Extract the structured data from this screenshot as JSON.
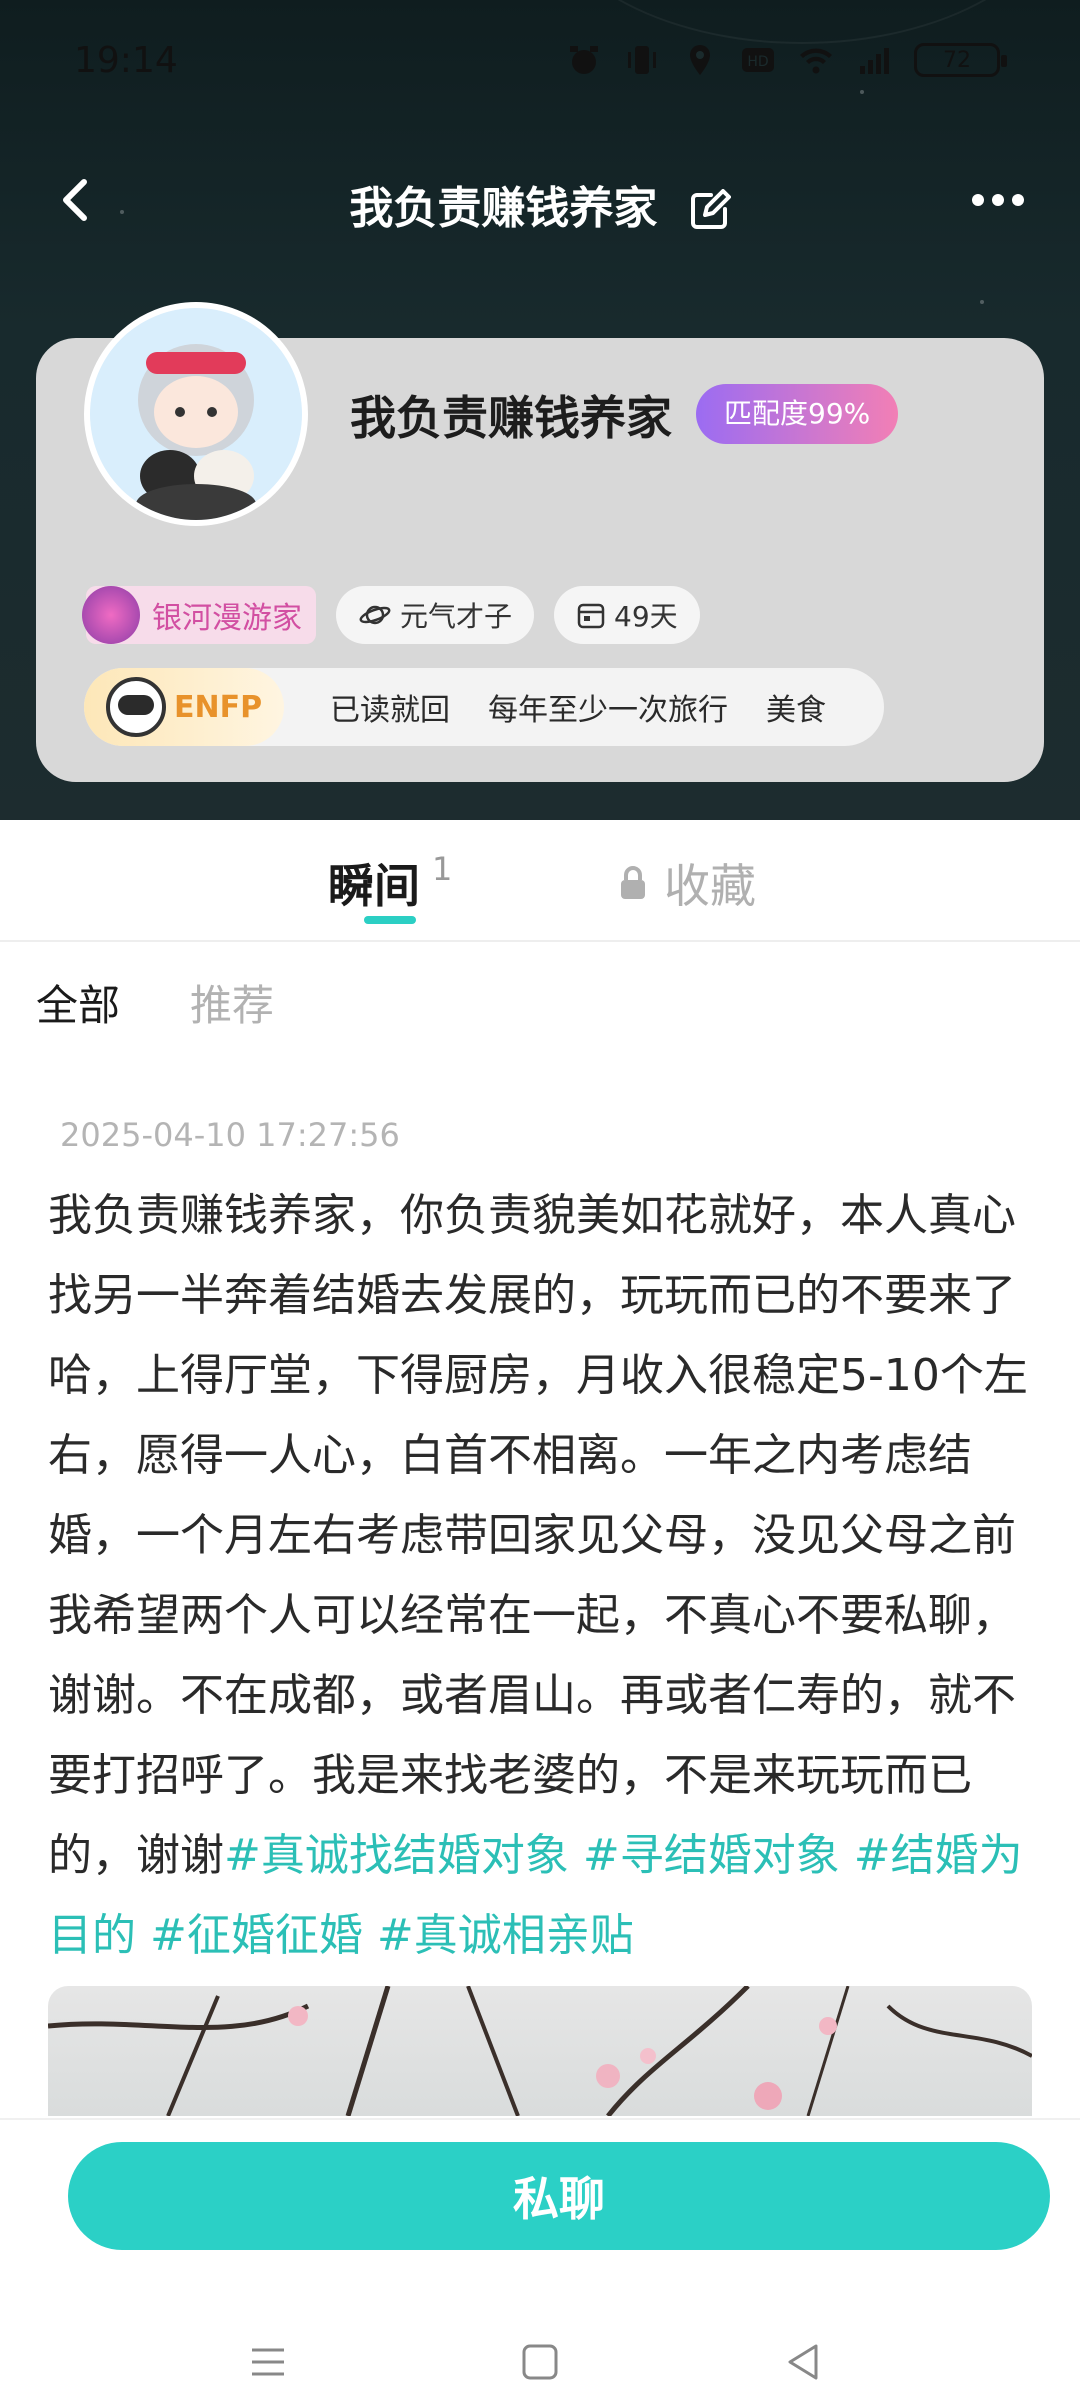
{
  "status_bar": {
    "time": "19:14",
    "battery": "72"
  },
  "nav": {
    "title": "我负责赚钱养家"
  },
  "profile": {
    "name": "我负责赚钱养家",
    "match": "匹配度99%",
    "galaxy_badge": "银河漫游家",
    "chip_trait": "元气才子",
    "chip_days": "49天",
    "mbti": "ENFP",
    "tags": [
      "已读就回",
      "每年至少一次旅行",
      "美食"
    ]
  },
  "tabs": {
    "moments": "瞬间",
    "moments_count": "1",
    "favorites": "收藏"
  },
  "subtabs": {
    "all": "全部",
    "recommended": "推荐"
  },
  "post": {
    "date": "2025-04-10 17:27:56",
    "text": "我负责赚钱养家，你负责貌美如花就好，本人真心找另一半奔着结婚去发展的，玩玩而已的不要来了哈，上得厅堂，下得厨房，月收入很稳定5-10个左右，愿得一人心，白首不相离。一年之内考虑结婚，一个月左右考虑带回家见父母，没见父母之前我希望两个人可以经常在一起，不真心不要私聊，谢谢。不在成都，或者眉山。再或者仁寿的，就不要打招呼了。我是来找老婆的，不是来玩玩而已的，谢谢",
    "hashtags": "#真诚找结婚对象 #寻结婚对象 #结婚为目的 #征婚征婚 #真诚相亲贴"
  },
  "actions": {
    "private_chat": "私聊"
  }
}
